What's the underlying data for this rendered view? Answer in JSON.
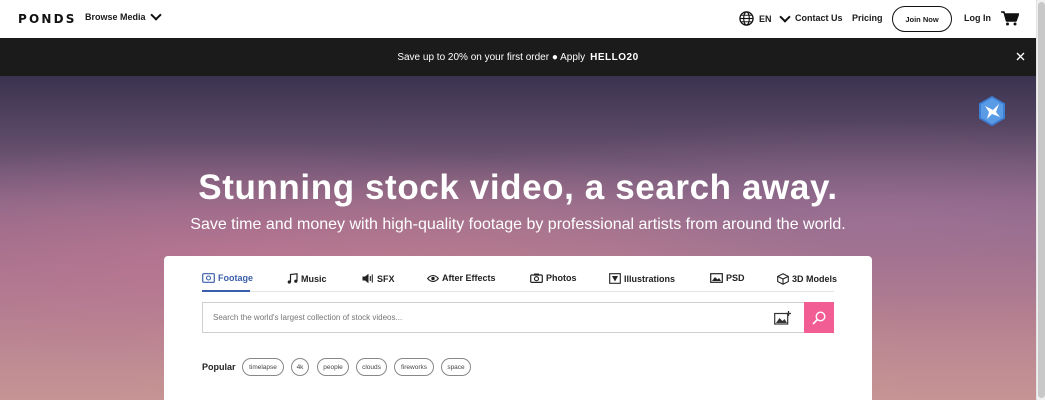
{
  "header": {
    "logo": "PONDS",
    "browse_label": "Browse Media",
    "language": "EN",
    "contact_label": "Contact Us",
    "pricing_label": "Pricing",
    "join_label": "Join Now",
    "login_label": "Log In",
    "icons": {
      "language": "globe-icon",
      "cart": "cart-icon",
      "browse": "chevron-down-icon"
    }
  },
  "promo": {
    "text": "Save up to 20% on your first order ● Apply",
    "code": "HELLO20",
    "close_icon": "close-icon"
  },
  "hero": {
    "title": "Stunning stock video, a search away.",
    "subtitle": "Save time and money with high-quality footage by professional artists from around the world."
  },
  "search": {
    "tabs": [
      {
        "label": "Footage",
        "icon": "film-icon",
        "active": true
      },
      {
        "label": "Music",
        "icon": "music-note-icon",
        "active": false
      },
      {
        "label": "SFX",
        "icon": "speaker-icon",
        "active": false
      },
      {
        "label": "After Effects",
        "icon": "eye-icon",
        "active": false
      },
      {
        "label": "Photos",
        "icon": "camera-icon",
        "active": false
      },
      {
        "label": "Illustrations",
        "icon": "pen-icon",
        "active": false
      },
      {
        "label": "PSD",
        "icon": "image-icon",
        "active": false
      },
      {
        "label": "3D Models",
        "icon": "cube-icon",
        "active": false
      }
    ],
    "placeholder": "Search the world's largest collection of stock videos...",
    "popular_label": "Popular",
    "popular_tags": [
      "timelapse",
      "4k",
      "people",
      "clouds",
      "fireworks",
      "space"
    ]
  },
  "colors": {
    "accent": "#f25d94",
    "active_tab": "#3a5faa",
    "promo_bg": "#1b1b1b"
  }
}
